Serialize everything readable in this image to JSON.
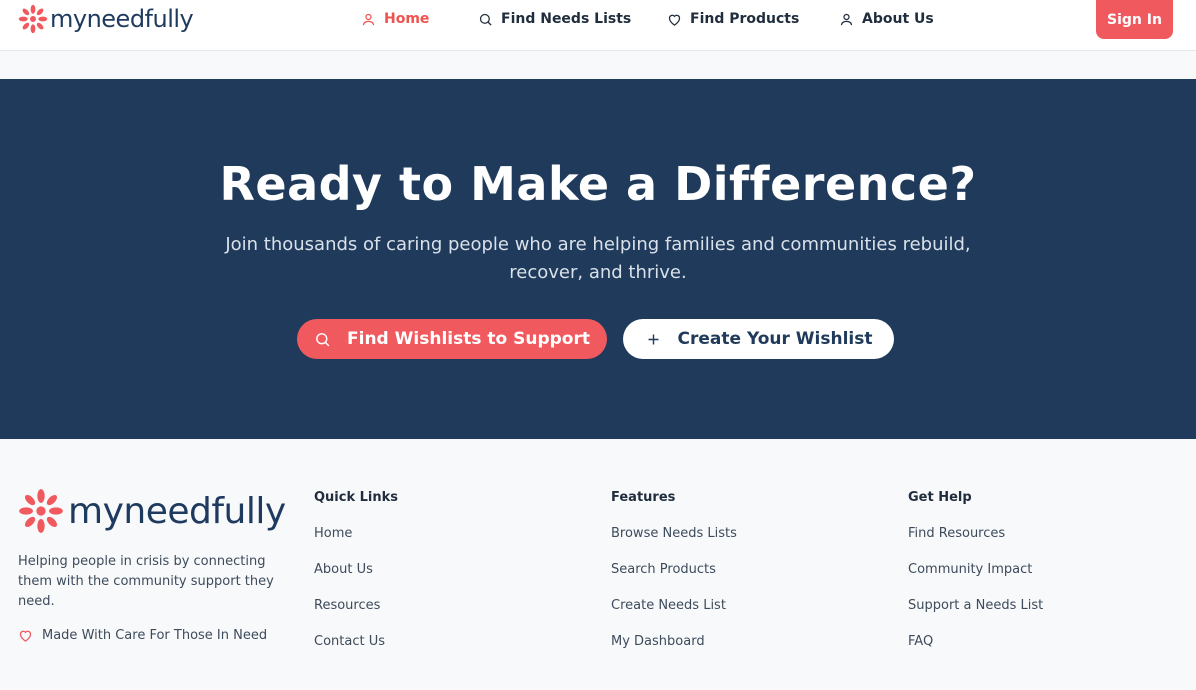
{
  "brand": {
    "name": "myneedfully",
    "accent": "#f05a5f",
    "navy": "#1f3a5a"
  },
  "header": {
    "nav": [
      {
        "label": "Home",
        "icon": "user-icon",
        "active": true
      },
      {
        "label": "Find Needs Lists",
        "icon": "search-icon"
      },
      {
        "label": "Find Products",
        "icon": "heart-icon"
      },
      {
        "label": "About Us",
        "icon": "user-icon"
      }
    ],
    "signin_label": "Sign In"
  },
  "hero": {
    "title": "Ready to Make a Difference?",
    "subtitle": "Join thousands of caring people who are helping families and communities rebuild, recover, and thrive.",
    "primary_button": "Find Wishlists to Support",
    "secondary_button": "Create Your Wishlist"
  },
  "footer": {
    "description": "Helping people in crisis by connecting them with the community support they need.",
    "made_with": "Made With Care For Those In Need",
    "columns": [
      {
        "title": "Quick Links",
        "links": [
          "Home",
          "About Us",
          "Resources",
          "Contact Us"
        ]
      },
      {
        "title": "Features",
        "links": [
          "Browse Needs Lists",
          "Search Products",
          "Create Needs List",
          "My Dashboard"
        ]
      },
      {
        "title": "Get Help",
        "links": [
          "Find Resources",
          "Community Impact",
          "Support a Needs List",
          "FAQ"
        ]
      }
    ]
  }
}
